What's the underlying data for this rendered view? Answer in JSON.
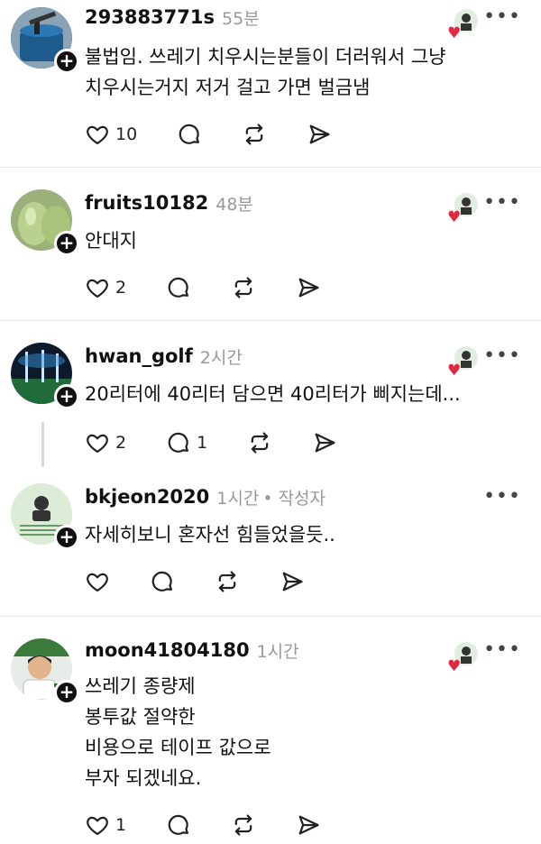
{
  "posts": [
    {
      "username": "293883771s",
      "time": "55분",
      "lines": [
        "불법임. 쓰레기 치우시는분들이 더러워서 그냥",
        "치우시는거지 저거 걸고 가면 벌금냄"
      ],
      "likes": "10",
      "replies": "",
      "liked_by_author": true
    },
    {
      "username": "fruits10182",
      "time": "48분",
      "lines": [
        "안대지"
      ],
      "likes": "2",
      "replies": "",
      "liked_by_author": true
    },
    {
      "username": "hwan_golf",
      "time": "2시간",
      "lines": [
        "20리터에 40리터 담으면 40리터가 삐지는데..."
      ],
      "likes": "2",
      "replies": "1",
      "liked_by_author": true
    },
    {
      "username": "bkjeon2020",
      "time": "1시간",
      "author_tag": "• 작성자",
      "lines": [
        "자세히보니 혼자선 힘들었을듯.."
      ],
      "likes": "",
      "replies": "",
      "liked_by_author": false
    },
    {
      "username": "moon41804180",
      "time": "1시간",
      "lines": [
        "쓰레기 종량제",
        "봉투값 절약한",
        "비용으로 테이프 값으로",
        "부자 되겠네요."
      ],
      "likes": "1",
      "replies": "",
      "liked_by_author": true
    }
  ],
  "icons": {
    "like": "heart-outline-icon",
    "reply": "speech-bubble-icon",
    "repost": "repost-arrows-icon",
    "share": "send-paper-plane-icon",
    "more": "more-dots-icon",
    "follow": "plus-icon"
  },
  "colors": {
    "like_heart": "#e02a43",
    "meta_gray": "#999999",
    "text": "#111111"
  }
}
